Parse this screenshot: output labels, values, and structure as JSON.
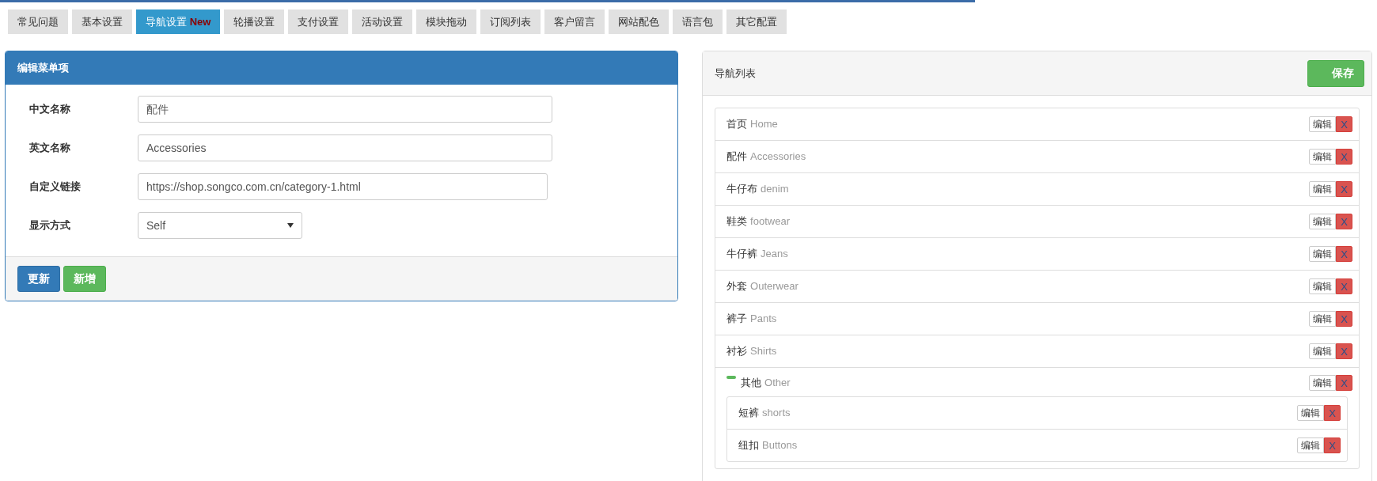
{
  "tabs": [
    {
      "label": "常见问题",
      "selected": false
    },
    {
      "label": "基本设置",
      "selected": false
    },
    {
      "label": "导航设置",
      "badge": "New",
      "selected": true
    },
    {
      "label": "轮播设置",
      "selected": false
    },
    {
      "label": "支付设置",
      "selected": false
    },
    {
      "label": "活动设置",
      "selected": false
    },
    {
      "label": "模块拖动",
      "selected": false
    },
    {
      "label": "订阅列表",
      "selected": false
    },
    {
      "label": "客户留言",
      "selected": false
    },
    {
      "label": "网站配色",
      "selected": false
    },
    {
      "label": "语言包",
      "selected": false
    },
    {
      "label": "其它配置",
      "selected": false
    }
  ],
  "edit_panel": {
    "title": "编辑菜单项",
    "fields": [
      {
        "kind": "text",
        "label": "中文名称",
        "value": "配件"
      },
      {
        "kind": "text",
        "label": "英文名称",
        "value": "Accessories"
      },
      {
        "kind": "url",
        "label": "自定义链接",
        "value": "https://shop.songco.com.cn/category-1.html"
      },
      {
        "kind": "select",
        "label": "显示方式",
        "value": "Self"
      }
    ],
    "buttons": [
      {
        "label": "更新",
        "kind": "primary"
      },
      {
        "label": "新增",
        "kind": "success"
      }
    ]
  },
  "nav_panel": {
    "title": "导航列表",
    "save_button": "保存",
    "items": [
      {
        "name": "首页",
        "english": "Home",
        "edit": "编辑",
        "delete": "X"
      },
      {
        "name": "配件",
        "english": "Accessories",
        "edit": "编辑",
        "delete": "X"
      },
      {
        "name": "牛仔布",
        "english": "denim",
        "edit": "编辑",
        "delete": "X"
      },
      {
        "name": "鞋类",
        "english": "footwear",
        "edit": "编辑",
        "delete": "X"
      },
      {
        "name": "牛仔裤",
        "english": "Jeans",
        "edit": "编辑",
        "delete": "X"
      },
      {
        "name": "外套",
        "english": "Outerwear",
        "edit": "编辑",
        "delete": "X"
      },
      {
        "name": "裤子",
        "english": "Pants",
        "edit": "编辑",
        "delete": "X"
      },
      {
        "name": "衬衫",
        "english": "Shirts",
        "edit": "编辑",
        "delete": "X"
      },
      {
        "name": "其他",
        "english": "Other",
        "edit": "编辑",
        "delete": "X",
        "expanded": true,
        "children": [
          {
            "name": "短裤",
            "english": "shorts",
            "edit": "编辑",
            "delete": "X"
          },
          {
            "name": "纽扣",
            "english": "Buttons",
            "edit": "编辑",
            "delete": "X"
          }
        ]
      }
    ]
  }
}
